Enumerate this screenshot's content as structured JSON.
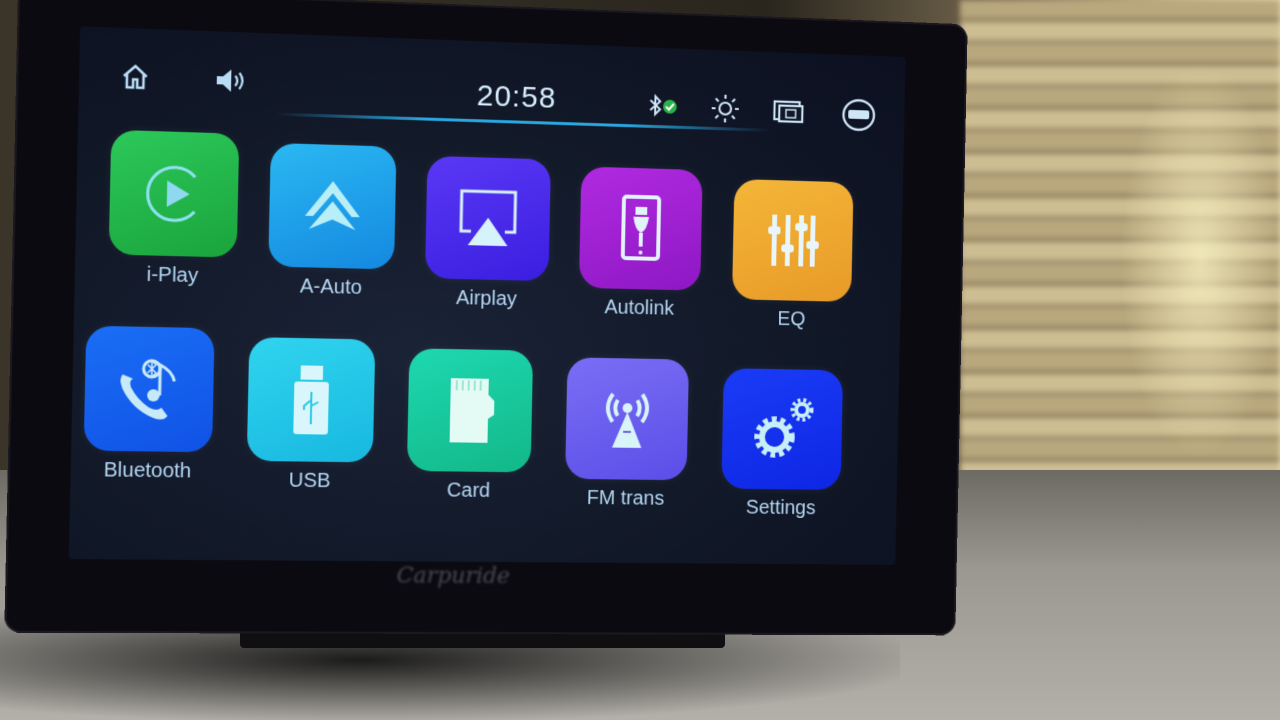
{
  "status_bar": {
    "home_icon": "home-icon",
    "volume_icon": "volume-icon",
    "time": "20:58",
    "bluetooth_icon": "bluetooth-connected-icon",
    "brightness_icon": "brightness-icon",
    "multiwindow_icon": "screen-mirror-icon",
    "help_icon": "help-icon"
  },
  "apps": [
    {
      "label": "i-Play",
      "icon": "carplay-icon",
      "color": "#22b54c"
    },
    {
      "label": "A-Auto",
      "icon": "android-auto-icon",
      "color": "#1aa0ee"
    },
    {
      "label": "Airplay",
      "icon": "airplay-icon",
      "color": "#4b2cf0"
    },
    {
      "label": "Autolink",
      "icon": "autolink-phone-icon",
      "color": "#a020d0"
    },
    {
      "label": "EQ",
      "icon": "equalizer-icon",
      "color": "#f0a830"
    },
    {
      "label": "Bluetooth",
      "icon": "bluetooth-phone-music-icon",
      "color": "#1560f0"
    },
    {
      "label": "USB",
      "icon": "usb-drive-icon",
      "color": "#22c8ea"
    },
    {
      "label": "Card",
      "icon": "sd-card-icon",
      "color": "#18c898"
    },
    {
      "label": "FM trans",
      "icon": "fm-antenna-icon",
      "color": "#6a5ef0"
    },
    {
      "label": "Settings",
      "icon": "settings-gears-icon",
      "color": "#1030f0"
    }
  ],
  "device": {
    "brand": "Carpuride"
  }
}
